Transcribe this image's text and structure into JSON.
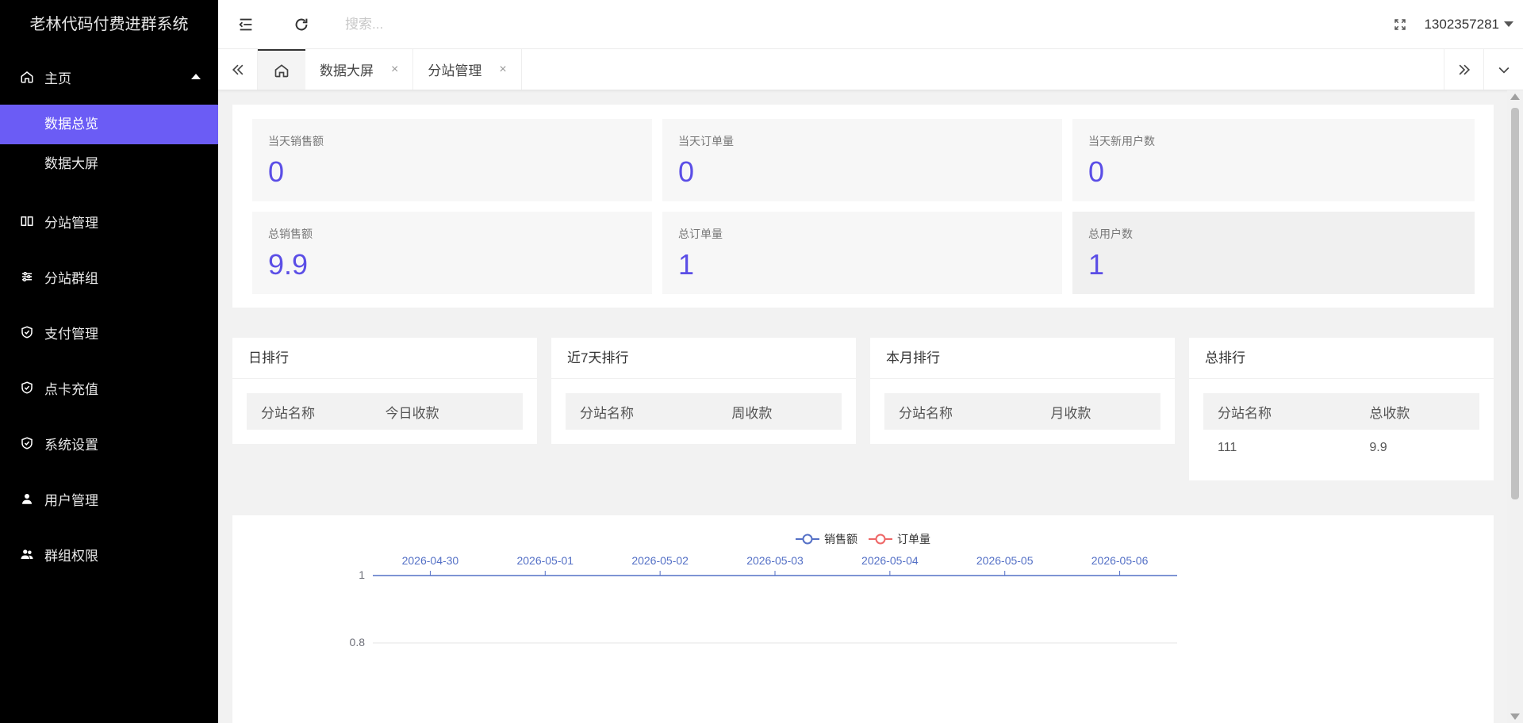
{
  "app": {
    "title": "老林代码付费进群系统"
  },
  "sidebar": {
    "items": [
      {
        "label": "主页",
        "icon": "home-icon",
        "expanded": true,
        "children": [
          {
            "label": "数据总览",
            "active": true
          },
          {
            "label": "数据大屏",
            "active": false
          }
        ]
      },
      {
        "label": "分站管理",
        "icon": "columns-icon"
      },
      {
        "label": "分站群组",
        "icon": "sliders-icon"
      },
      {
        "label": "支付管理",
        "icon": "shield-check-icon"
      },
      {
        "label": "点卡充值",
        "icon": "shield-check-icon"
      },
      {
        "label": "系统设置",
        "icon": "shield-check-icon"
      },
      {
        "label": "用户管理",
        "icon": "user-icon"
      },
      {
        "label": "群组权限",
        "icon": "users-icon"
      }
    ]
  },
  "header": {
    "search_placeholder": "搜索...",
    "username": "1302357281"
  },
  "tabs": {
    "items": [
      {
        "label": "数据大屏"
      },
      {
        "label": "分站管理"
      }
    ],
    "close_glyph": "×"
  },
  "stats": [
    {
      "label": "当天销售额",
      "value": "0"
    },
    {
      "label": "当天订单量",
      "value": "0"
    },
    {
      "label": "当天新用户数",
      "value": "0"
    },
    {
      "label": "总销售额",
      "value": "9.9"
    },
    {
      "label": "总订单量",
      "value": "1"
    },
    {
      "label": "总用户数",
      "value": "1"
    }
  ],
  "rankings": [
    {
      "title": "日排行",
      "col1": "分站名称",
      "col2": "今日收款",
      "rows": []
    },
    {
      "title": "近7天排行",
      "col1": "分站名称",
      "col2": "周收款",
      "rows": []
    },
    {
      "title": "本月排行",
      "col1": "分站名称",
      "col2": "月收款",
      "rows": []
    },
    {
      "title": "总排行",
      "col1": "分站名称",
      "col2": "总收款",
      "rows": [
        {
          "name": "111",
          "amount": "9.9"
        }
      ]
    }
  ],
  "chart_data": {
    "type": "line",
    "x": [
      "2026-04-30",
      "2026-05-01",
      "2026-05-02",
      "2026-05-03",
      "2026-05-04",
      "2026-05-05",
      "2026-05-06"
    ],
    "series": [
      {
        "name": "销售额",
        "color": "#5470c6",
        "values": []
      },
      {
        "name": "订单量",
        "color": "#ee6666",
        "values": []
      }
    ],
    "y_ticks": [
      "1",
      "0.8"
    ],
    "ylim": [
      0,
      1
    ],
    "x_axis_position": "top",
    "legend_position": "top-center",
    "grid": true
  }
}
